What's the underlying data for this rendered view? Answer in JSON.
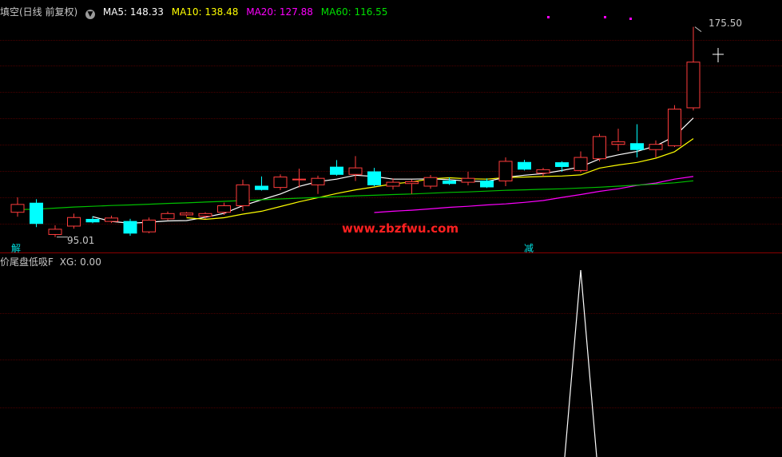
{
  "header": {
    "title": "填空(日线 前复权)",
    "ma5": "MA5: 148.33",
    "ma10": "MA10: 138.48",
    "ma20": "MA20: 127.88",
    "ma60": "MA60: 116.55"
  },
  "colors": {
    "up": "#ff3c3c",
    "down": "#00ffff",
    "ma5": "#ffffff",
    "ma10": "#ffff00",
    "ma20": "#ff00ff",
    "ma60": "#00c000",
    "grid": "#4a0000",
    "separator": "#8a0000",
    "watermark": "#ff2020"
  },
  "annotations": {
    "high_label": "175.50",
    "low_label": "95.01",
    "signal_jie": "解",
    "signal_jian": "减",
    "watermark": "www.zbzfwu.com"
  },
  "indicator": {
    "title": "价尾盘低吸F",
    "xg_label": "XG: 0.00"
  },
  "chart_data": [
    {
      "type": "candlestick",
      "title": "填空(日线 前复权)",
      "ylim": [
        90,
        180
      ],
      "candles": [
        {
          "o": 104.5,
          "h": 110.2,
          "l": 102.8,
          "c": 107.5
        },
        {
          "o": 108.0,
          "h": 109.5,
          "l": 98.8,
          "c": 100.2
        },
        {
          "o": 96.0,
          "h": 99.5,
          "l": 95.0,
          "c": 98.0
        },
        {
          "o": 99.2,
          "h": 104.0,
          "l": 98.2,
          "c": 102.5
        },
        {
          "o": 101.8,
          "h": 103.0,
          "l": 100.3,
          "c": 100.8
        },
        {
          "o": 101.0,
          "h": 103.2,
          "l": 100.4,
          "c": 102.3
        },
        {
          "o": 101.0,
          "h": 102.0,
          "l": 95.5,
          "c": 96.5
        },
        {
          "o": 97.0,
          "h": 102.5,
          "l": 96.5,
          "c": 101.5
        },
        {
          "o": 102.0,
          "h": 104.8,
          "l": 101.5,
          "c": 104.0
        },
        {
          "o": 103.5,
          "h": 104.6,
          "l": 102.8,
          "c": 104.2
        },
        {
          "o": 103.0,
          "h": 104.5,
          "l": 102.0,
          "c": 104.0
        },
        {
          "o": 104.5,
          "h": 108.2,
          "l": 103.5,
          "c": 107.0
        },
        {
          "o": 107.0,
          "h": 117.0,
          "l": 105.0,
          "c": 115.0
        },
        {
          "o": 114.5,
          "h": 118.2,
          "l": 112.8,
          "c": 113.2
        },
        {
          "o": 114.0,
          "h": 119.0,
          "l": 113.0,
          "c": 118.0
        },
        {
          "o": 117.0,
          "h": 121.2,
          "l": 114.0,
          "c": 117.2
        },
        {
          "o": 115.0,
          "h": 118.5,
          "l": 111.5,
          "c": 117.5
        },
        {
          "o": 121.8,
          "h": 124.5,
          "l": 118.5,
          "c": 119.0
        },
        {
          "o": 119.0,
          "h": 126.0,
          "l": 116.5,
          "c": 121.5
        },
        {
          "o": 120.0,
          "h": 121.5,
          "l": 114.5,
          "c": 115.0
        },
        {
          "o": 114.5,
          "h": 117.5,
          "l": 113.2,
          "c": 116.0
        },
        {
          "o": 115.5,
          "h": 117.0,
          "l": 111.5,
          "c": 116.2
        },
        {
          "o": 114.5,
          "h": 118.8,
          "l": 113.5,
          "c": 117.8
        },
        {
          "o": 116.5,
          "h": 117.8,
          "l": 115.0,
          "c": 115.5
        },
        {
          "o": 116.0,
          "h": 120.0,
          "l": 114.8,
          "c": 117.5
        },
        {
          "o": 116.5,
          "h": 117.5,
          "l": 113.8,
          "c": 114.2
        },
        {
          "o": 116.5,
          "h": 125.5,
          "l": 114.5,
          "c": 124.0
        },
        {
          "o": 123.6,
          "h": 124.6,
          "l": 120.5,
          "c": 121.0
        },
        {
          "o": 119.5,
          "h": 121.5,
          "l": 118.2,
          "c": 120.8
        },
        {
          "o": 123.5,
          "h": 124.0,
          "l": 120.0,
          "c": 122.0
        },
        {
          "o": 120.5,
          "h": 127.8,
          "l": 119.8,
          "c": 125.5
        },
        {
          "o": 125.0,
          "h": 134.5,
          "l": 124.0,
          "c": 133.5
        },
        {
          "o": 130.5,
          "h": 136.5,
          "l": 128.0,
          "c": 131.5
        },
        {
          "o": 130.8,
          "h": 138.2,
          "l": 125.5,
          "c": 128.5
        },
        {
          "o": 128.5,
          "h": 132.0,
          "l": 125.5,
          "c": 130.5
        },
        {
          "o": 130.0,
          "h": 145.5,
          "l": 129.5,
          "c": 144.0
        },
        {
          "o": 144.5,
          "h": 175.5,
          "l": 143.5,
          "c": 162.0
        }
      ],
      "series": [
        {
          "name": "MA5",
          "values": [
            null,
            null,
            null,
            null,
            102.8,
            101.0,
            100.3,
            100.7,
            101.2,
            101.3,
            102.6,
            104.1,
            107.0,
            109.3,
            111.5,
            114.4,
            116.2,
            117.2,
            118.7,
            118.2,
            117.2,
            117.2,
            117.3,
            117.0,
            116.4,
            116.3,
            117.9,
            118.7,
            119.3,
            120.5,
            121.9,
            124.9,
            126.5,
            127.8,
            129.9,
            133.6,
            140.6
          ]
        },
        {
          "name": "MA10",
          "values": [
            null,
            null,
            null,
            null,
            null,
            null,
            null,
            null,
            null,
            102.4,
            101.8,
            102.4,
            103.8,
            104.9,
            106.7,
            108.5,
            110.1,
            111.7,
            113.1,
            114.2,
            115.4,
            116.1,
            117.3,
            117.7,
            117.3,
            117.2,
            117.8,
            118.0,
            118.2,
            118.4,
            118.8,
            121.4,
            122.6,
            123.6,
            125.2,
            127.7,
            132.7
          ]
        },
        {
          "name": "MA20",
          "values": [
            null,
            null,
            null,
            null,
            null,
            null,
            null,
            null,
            null,
            null,
            null,
            null,
            null,
            null,
            null,
            null,
            null,
            null,
            null,
            104.4,
            104.9,
            105.3,
            105.8,
            106.4,
            106.8,
            107.3,
            107.7,
            108.3,
            109.0,
            110.2,
            111.3,
            112.5,
            113.5,
            114.8,
            115.7,
            117.2,
            118.2
          ]
        },
        {
          "name": "MA60",
          "values": [
            105.5,
            105.7,
            106.1,
            106.5,
            106.8,
            107.1,
            107.3,
            107.6,
            107.9,
            108.1,
            108.4,
            108.7,
            109.0,
            109.3,
            109.6,
            109.9,
            110.2,
            110.5,
            110.8,
            111.0,
            111.3,
            111.5,
            111.8,
            112.1,
            112.3,
            112.6,
            112.9,
            113.1,
            113.3,
            113.5,
            113.8,
            114.1,
            114.5,
            114.9,
            115.3,
            115.8,
            116.55
          ]
        }
      ]
    },
    {
      "type": "line",
      "title": "价尾盘低吸F",
      "ylim": [
        0,
        1
      ],
      "series": [
        {
          "name": "XG",
          "values": [
            0,
            0,
            0,
            0,
            0,
            0,
            0,
            0,
            0,
            0,
            0,
            0,
            0,
            0,
            0,
            0,
            0,
            0,
            0,
            0,
            0,
            0,
            0,
            0,
            0,
            0,
            0,
            0,
            0,
            0,
            1,
            0,
            0,
            0,
            0,
            0,
            0
          ]
        }
      ]
    }
  ]
}
